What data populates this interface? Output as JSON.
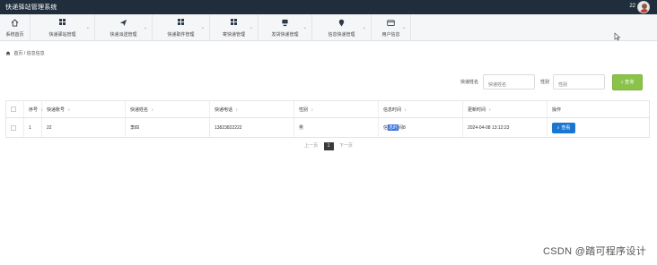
{
  "app": {
    "title": "快递驿站管理系统",
    "user": "22"
  },
  "nav": [
    {
      "label": "系统首页",
      "icon": "home-icon"
    },
    {
      "label": "快递驿站管理",
      "icon": "grid-icon"
    },
    {
      "label": "快递派送管理",
      "icon": "paper-plane-icon"
    },
    {
      "label": "快递取件管理",
      "icon": "grid-icon"
    },
    {
      "label": "寄快递管理",
      "icon": "grid-icon"
    },
    {
      "label": "发货快递管理",
      "icon": "server-icon"
    },
    {
      "label": "信息快递管理",
      "icon": "map-pin-icon"
    },
    {
      "label": "用户信息",
      "icon": "id-card-icon"
    }
  ],
  "breadcrumb": {
    "home": "首页",
    "sep": "/",
    "current": "信息信息"
  },
  "search": {
    "name_label": "快递姓名",
    "name_placeholder": "快递姓名",
    "gender_label": "性别",
    "gender_placeholder": "性别",
    "button": "查询"
  },
  "table": {
    "headers": [
      "序号",
      "快递账号",
      "快递姓名",
      "快递电话",
      "性别",
      "信息时间",
      "更新时间",
      "操作"
    ],
    "rows": [
      {
        "index": "1",
        "account": "22",
        "name": "李四",
        "phone": "13823822222",
        "gender": "男",
        "time_pre": "信",
        "time_hl": "息时",
        "time_post": "间8",
        "updated": "2024-04-08 13:12:23",
        "action": "查看"
      }
    ]
  },
  "pager": {
    "prev": "上一页",
    "current": "1",
    "next": "下一页"
  },
  "watermark": "CSDN @踏可程序设计"
}
